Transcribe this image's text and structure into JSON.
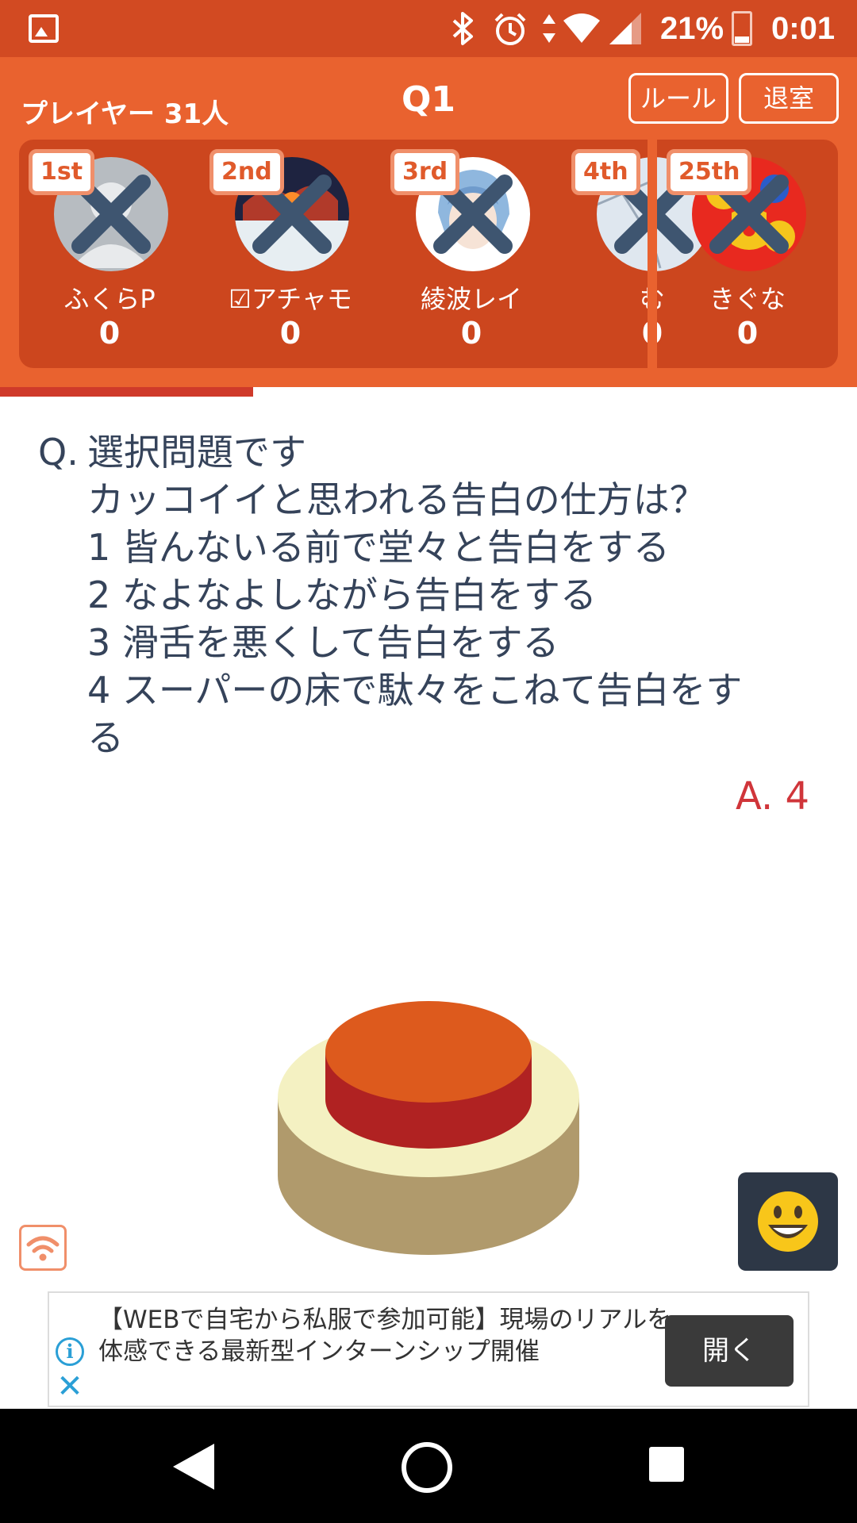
{
  "status_bar": {
    "battery_percent": "21%",
    "time": "0:01",
    "icons": [
      "gallery-icon",
      "bluetooth-icon",
      "alarm-icon",
      "data-arrows-icon",
      "wifi-icon",
      "signal-icon",
      "battery-icon"
    ]
  },
  "header": {
    "players_count": "プレイヤー 31人",
    "question_number": "Q1",
    "rules_label": "ルール",
    "exit_label": "退室"
  },
  "players": [
    {
      "rank": "1st",
      "name": "ふくらP",
      "score": "0",
      "eliminated": true
    },
    {
      "rank": "2nd",
      "name": "☑アチャモ",
      "score": "0",
      "eliminated": true
    },
    {
      "rank": "3rd",
      "name": "綾波レイ",
      "score": "0",
      "eliminated": true
    },
    {
      "rank": "4th",
      "name": "む",
      "score": "0",
      "eliminated": true
    }
  ],
  "my_player": {
    "rank": "25th",
    "name": "きぐな",
    "score": "0",
    "eliminated": true
  },
  "progress": {
    "fraction": 0.295
  },
  "question": {
    "label": "Q.",
    "lines": [
      "選択問題です",
      "カッコイイと思われる告白の仕方は？",
      "1  皆んないる前で堂々と告白をする",
      "2  なよなよしながら告白をする",
      "3  滑舌を悪くして告白をする",
      "4  スーパーの床で駄々をこねて告白をす",
      "る"
    ]
  },
  "answer": "A. 4",
  "ad": {
    "text": "【WEBで自宅から私服で参加可能】現場のリアルを体感できる最新型インターンシップ開催",
    "open_label": "開く",
    "info_icon": "i"
  },
  "colors": {
    "header": "#e9622f",
    "status_bar": "#d24a22",
    "panel": "#cc461e",
    "answer": "#d0353a",
    "buzzer_top": "#dd5a1d",
    "buzzer_side": "#b02222",
    "buzzer_base_top": "#f4f1c2",
    "buzzer_base_side": "#b09a6c"
  }
}
